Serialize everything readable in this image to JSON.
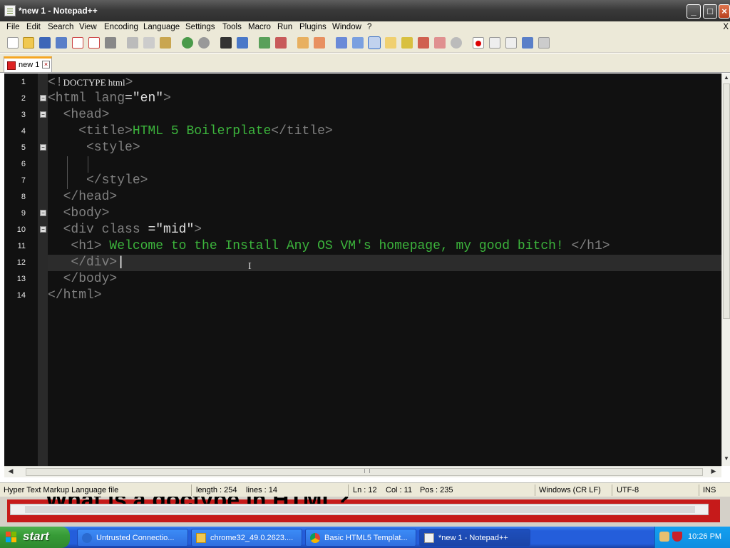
{
  "window": {
    "title": "*new 1 - Notepad++"
  },
  "menu": {
    "items": [
      "File",
      "Edit",
      "Search",
      "View",
      "Encoding",
      "Language",
      "Settings",
      "Tools",
      "Macro",
      "Run",
      "Plugins",
      "Window",
      "?"
    ],
    "close_mark": "X"
  },
  "tab": {
    "label": "new 1"
  },
  "editor": {
    "line_numbers": [
      "1",
      "2",
      "3",
      "4",
      "5",
      "6",
      "7",
      "8",
      "9",
      "10",
      "11",
      "12",
      "13",
      "14"
    ],
    "lines": [
      {
        "a": "<!",
        "b": "DOCTYPE html",
        "c": ">"
      },
      {
        "a": "<html lang",
        "b": "=",
        "c": "\"en\"",
        "d": ">"
      },
      {
        "a": "  <head>"
      },
      {
        "a": "    <title>",
        "b": "HTML 5 Boilerplate",
        "c": "</title>"
      },
      {
        "a": "     <style>"
      },
      {
        "a": "      "
      },
      {
        "a": "     </style>"
      },
      {
        "a": "  </head>"
      },
      {
        "a": "  <body>"
      },
      {
        "a": "  <div class ",
        "b": "=",
        "c": "\"mid\"",
        "d": ">"
      },
      {
        "a": "   <h1> ",
        "b": "Welcome to the Install Any OS VM's homepage, my good bitch!",
        "c": " </h1>"
      },
      {
        "a": "   </div>"
      },
      {
        "a": "  </body>"
      },
      {
        "a": "</html>"
      }
    ]
  },
  "status": {
    "file_type": "Hyper Text Markup Language file",
    "length": "length : 254",
    "lines": "lines : 14",
    "ln": "Ln : 12",
    "col": "Col : 11",
    "pos": "Pos : 235",
    "eol": "Windows (CR LF)",
    "encoding": "UTF-8",
    "mode": "INS"
  },
  "background_window": {
    "heading_fragment": "What is a doctype in HTML?"
  },
  "taskbar": {
    "start_label": "start",
    "items": [
      {
        "label": "Untrusted Connectio...",
        "icon": "ie-icon"
      },
      {
        "label": "chrome32_49.0.2623....",
        "icon": "folder-icon"
      },
      {
        "label": "Basic HTML5 Templat...",
        "icon": "chrome-icon"
      },
      {
        "label": "*new 1 - Notepad++",
        "icon": "notepad-icon"
      }
    ],
    "clock": "10:26 PM"
  }
}
